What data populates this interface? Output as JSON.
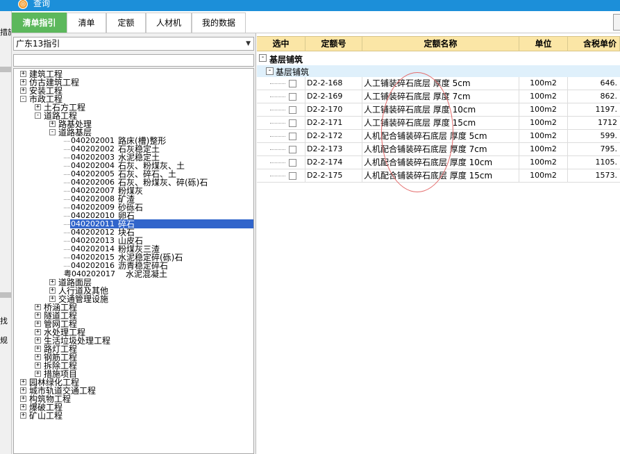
{
  "window": {
    "title": "查询"
  },
  "background_window": {
    "fragments": [
      "措施",
      "找",
      "规"
    ]
  },
  "tabs": [
    "清单指引",
    "清单",
    "定额",
    "人材机",
    "我的数据"
  ],
  "left": {
    "select_value": "广东13指引",
    "search_value": "",
    "tree": [
      {
        "type": "node",
        "exp": "+",
        "label": "建筑工程"
      },
      {
        "type": "node",
        "exp": "+",
        "label": "仿古建筑工程"
      },
      {
        "type": "node",
        "exp": "+",
        "label": "安装工程"
      },
      {
        "type": "node",
        "exp": "-",
        "label": "市政工程"
      },
      {
        "type": "node",
        "exp": "+",
        "label": "土石方工程"
      },
      {
        "type": "node",
        "exp": "-",
        "label": "道路工程"
      },
      {
        "type": "node",
        "exp": "+",
        "label": "路基处理"
      },
      {
        "type": "node",
        "exp": "-",
        "label": "道路基层"
      },
      {
        "type": "leaf",
        "code": "040202001",
        "name": "路床(槽)整形"
      },
      {
        "type": "leaf",
        "code": "040202002",
        "name": "石灰稳定土"
      },
      {
        "type": "leaf",
        "code": "040202003",
        "name": "水泥稳定土"
      },
      {
        "type": "leaf",
        "code": "040202004",
        "name": "石灰、粉煤灰、土"
      },
      {
        "type": "leaf",
        "code": "040202005",
        "name": "石灰、碎石、土"
      },
      {
        "type": "leaf",
        "code": "040202006",
        "name": "石灰、粉煤灰、碎(砾)石"
      },
      {
        "type": "leaf",
        "code": "040202007",
        "name": "粉煤灰"
      },
      {
        "type": "leaf",
        "code": "040202008",
        "name": "矿渣"
      },
      {
        "type": "leaf",
        "code": "040202009",
        "name": "砂砾石"
      },
      {
        "type": "leaf",
        "code": "040202010",
        "name": "卵石"
      },
      {
        "type": "leaf",
        "code": "040202011",
        "name": "碎石"
      },
      {
        "type": "leaf",
        "code": "040202012",
        "name": "块石"
      },
      {
        "type": "leaf",
        "code": "040202013",
        "name": "山皮石"
      },
      {
        "type": "leaf",
        "code": "040202014",
        "name": "粉煤灰三渣"
      },
      {
        "type": "leaf",
        "code": "040202015",
        "name": "水泥稳定碎(砾)石"
      },
      {
        "type": "leaf",
        "code": "040202016",
        "name": "沥青稳定碎石"
      },
      {
        "type": "leaf",
        "code": "粤040202017",
        "name": "水泥混凝土"
      },
      {
        "type": "node",
        "exp": "+",
        "label": "道路面层"
      },
      {
        "type": "node",
        "exp": "+",
        "label": "人行道及其他"
      },
      {
        "type": "node",
        "exp": "+",
        "label": "交通管理设施"
      },
      {
        "type": "node",
        "exp": "+",
        "label": "桥涵工程"
      },
      {
        "type": "node",
        "exp": "+",
        "label": "隧道工程"
      },
      {
        "type": "node",
        "exp": "+",
        "label": "管网工程"
      },
      {
        "type": "node",
        "exp": "+",
        "label": "水处理工程"
      },
      {
        "type": "node",
        "exp": "+",
        "label": "生活垃圾处理工程"
      },
      {
        "type": "node",
        "exp": "+",
        "label": "路灯工程"
      },
      {
        "type": "node",
        "exp": "+",
        "label": "钢筋工程"
      },
      {
        "type": "node",
        "exp": "+",
        "label": "拆除工程"
      },
      {
        "type": "node",
        "exp": "+",
        "label": "措施项目"
      },
      {
        "type": "node",
        "exp": "+",
        "label": "园林绿化工程"
      },
      {
        "type": "node",
        "exp": "+",
        "label": "城市轨道交通工程"
      },
      {
        "type": "node",
        "exp": "+",
        "label": "构筑物工程"
      },
      {
        "type": "node",
        "exp": "+",
        "label": "爆破工程"
      },
      {
        "type": "node",
        "exp": "+",
        "label": "矿山工程"
      }
    ],
    "selected_code": "040202011"
  },
  "grid": {
    "headers": [
      "选中",
      "定额号",
      "定额名称",
      "单位",
      "含税单价"
    ],
    "group1": {
      "exp": "-",
      "label": "基层铺筑"
    },
    "group2": {
      "exp": "-",
      "label": "基层铺筑"
    },
    "rows": [
      {
        "code": "D2-2-168",
        "name": "人工铺装碎石底层 厚度 5cm",
        "unit": "100m2",
        "price": "646."
      },
      {
        "code": "D2-2-169",
        "name": "人工铺装碎石底层 厚度 7cm",
        "unit": "100m2",
        "price": "862."
      },
      {
        "code": "D2-2-170",
        "name": "人工铺装碎石底层 厚度 10cm",
        "unit": "100m2",
        "price": "1197."
      },
      {
        "code": "D2-2-171",
        "name": "人工铺装碎石底层 厚度 15cm",
        "unit": "100m2",
        "price": "1712"
      },
      {
        "code": "D2-2-172",
        "name": "人机配合铺装碎石底层 厚度 5cm",
        "unit": "100m2",
        "price": "599."
      },
      {
        "code": "D2-2-173",
        "name": "人机配合铺装碎石底层 厚度 7cm",
        "unit": "100m2",
        "price": "795."
      },
      {
        "code": "D2-2-174",
        "name": "人机配合铺装碎石底层 厚度 10cm",
        "unit": "100m2",
        "price": "1105."
      },
      {
        "code": "D2-2-175",
        "name": "人机配合铺装碎石底层 厚度 15cm",
        "unit": "100m2",
        "price": "1573."
      }
    ]
  },
  "colors": {
    "titlebar": "#1c8fd9",
    "active_tab": "#5cb85c",
    "grid_header": "#fbe6a6",
    "selection": "#3165cb",
    "annotation": "#e46a6a"
  }
}
